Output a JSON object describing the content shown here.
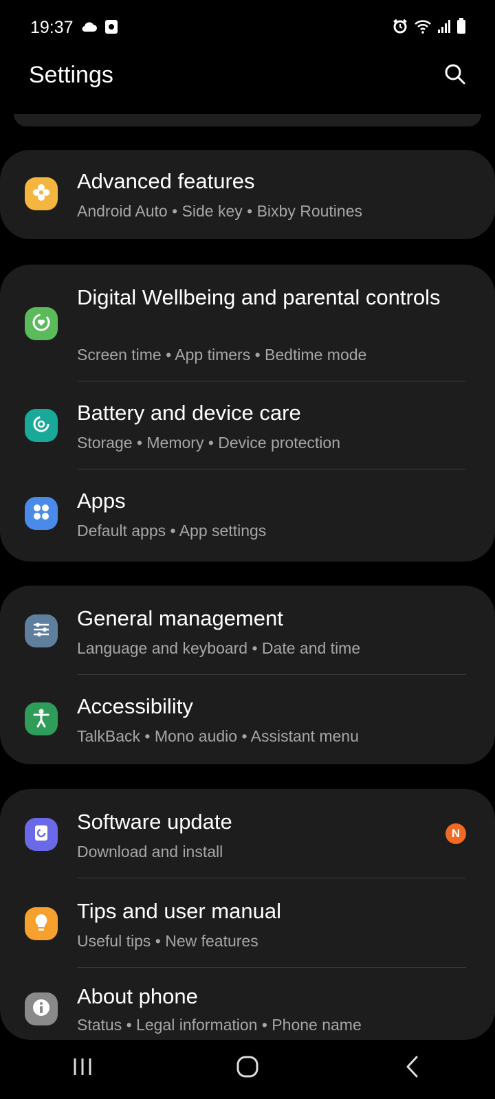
{
  "status": {
    "time": "19:37",
    "icons_left": [
      "cloud-icon",
      "screenshot-icon"
    ],
    "icons_right": [
      "alarm-icon",
      "wifi-icon",
      "signal-icon",
      "battery-icon"
    ]
  },
  "header": {
    "title": "Settings",
    "search_icon": "search-icon"
  },
  "groups": [
    {
      "items": [
        {
          "title": "Advanced features",
          "subtitle": "Android Auto  •  Side key  •  Bixby Routines",
          "icon": "advanced-features-icon",
          "color": "#f4b63f"
        }
      ]
    },
    {
      "items": [
        {
          "title": "Digital Wellbeing and parental controls",
          "subtitle": "Screen time  •  App timers  •  Bedtime mode",
          "icon": "digital-wellbeing-icon",
          "color": "#5bbb5b"
        },
        {
          "title": "Battery and device care",
          "subtitle": "Storage  •  Memory  •  Device protection",
          "icon": "device-care-icon",
          "color": "#19a999"
        },
        {
          "title": "Apps",
          "subtitle": "Default apps  •  App settings",
          "icon": "apps-icon",
          "color": "#4a8bea"
        }
      ]
    },
    {
      "items": [
        {
          "title": "General management",
          "subtitle": "Language and keyboard  •  Date and time",
          "icon": "general-management-icon",
          "color": "#5f7f9e"
        },
        {
          "title": "Accessibility",
          "subtitle": "TalkBack  •  Mono audio  •  Assistant menu",
          "icon": "accessibility-icon",
          "color": "#2f9c5a"
        }
      ]
    },
    {
      "items": [
        {
          "title": "Software update",
          "subtitle": "Download and install",
          "icon": "software-update-icon",
          "color": "#6a6ae8",
          "badge": "N"
        },
        {
          "title": "Tips and user manual",
          "subtitle": "Useful tips  •  New features",
          "icon": "tips-icon",
          "color": "#f6a02e"
        },
        {
          "title": "About phone",
          "subtitle": "Status  •  Legal information  •  Phone name",
          "icon": "info-icon",
          "color": "#8a8a8a"
        }
      ]
    }
  ],
  "navbar": {
    "recent": "recent-apps-icon",
    "home": "home-icon",
    "back": "back-icon"
  }
}
